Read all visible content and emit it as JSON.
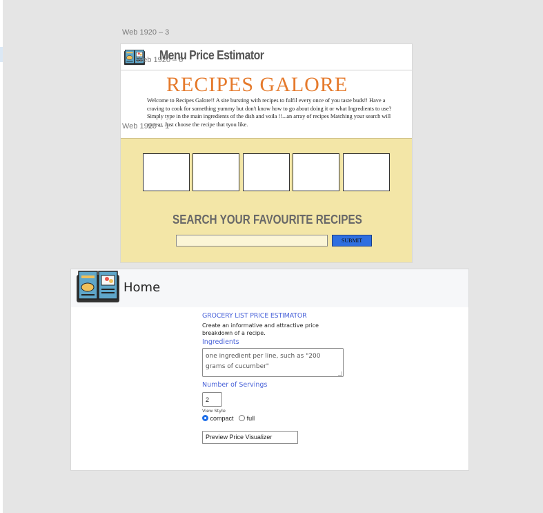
{
  "canvas": {
    "label_top": "Web 1920 – 3",
    "label_overlap": "Web 1920 – 6",
    "label_middle": "Web 1920 – 1"
  },
  "artboard1": {
    "header_title": "Menu Price Estimator",
    "brand": "RECIPES GALORE",
    "welcome_text": "Welcome to Recipes Galore!! A site bursting with recipes to fulfil every once of you taste buds!! Have a craving to cook for something yummy but don't know how to go about doing it or what Ingredients to use? Simply type in the main ingredients of the dish and voila !!...an array of recipes Matching your search will appear. Just choose the recipe that tyou like.",
    "recipe_slots": [
      "",
      "",
      "",
      "",
      ""
    ],
    "search_title": "SEARCH YOUR FAVOURITE RECIPES",
    "search_value": "",
    "submit_label": "SUBMIT",
    "colors": {
      "brand": "#e57a2c",
      "search_band": "#f3e6a7",
      "submit": "#2f6fe0"
    }
  },
  "artboard2": {
    "nav_title": "Home",
    "heading": "GROCERY LIST PRICE ESTIMATOR",
    "description": "Create an informative and attractive price breakdown of a recipe.",
    "ingredients_label": "Ingredients",
    "ingredients_placeholder": "one ingredient per line, such as \"200 grams of cucumber\"",
    "servings_label": "Number of Servings",
    "servings_value": "2",
    "view_style_label": "View Style",
    "view_options": [
      {
        "label": "compact",
        "checked": true
      },
      {
        "label": "full",
        "checked": false
      }
    ],
    "preview_button": "Preview Price Visualizer",
    "colors": {
      "accent": "#4a63d9"
    }
  }
}
